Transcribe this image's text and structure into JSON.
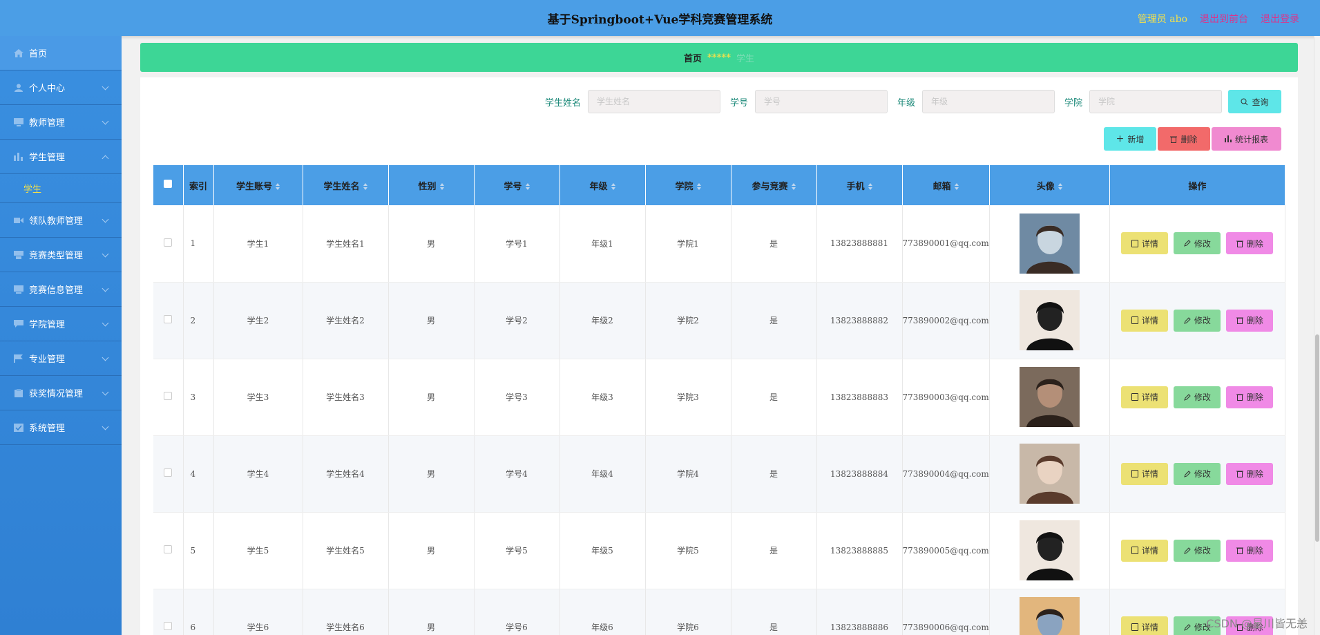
{
  "header": {
    "title": "基于Springboot+Vue学科竞赛管理系统",
    "admin": "管理员 abo",
    "back_to_front": "退出到前台",
    "logout": "退出登录"
  },
  "sidebar": {
    "items": [
      {
        "label": "首页",
        "icon": "home-icon"
      },
      {
        "label": "个人中心",
        "icon": "user-icon"
      },
      {
        "label": "教师管理",
        "icon": "monitor-icon"
      },
      {
        "label": "学生管理",
        "icon": "chart-icon"
      },
      {
        "label": "学生",
        "icon": ""
      },
      {
        "label": "领队教师管理",
        "icon": "video-icon"
      },
      {
        "label": "竞赛类型管理",
        "icon": "printer-icon"
      },
      {
        "label": "竞赛信息管理",
        "icon": "window-icon"
      },
      {
        "label": "学院管理",
        "icon": "chat-icon"
      },
      {
        "label": "专业管理",
        "icon": "flag-icon"
      },
      {
        "label": "获奖情况管理",
        "icon": "clipboard-icon"
      },
      {
        "label": "系统管理",
        "icon": "check-icon"
      }
    ]
  },
  "breadcrumb": {
    "home": "首页",
    "separator": "*****",
    "current": "学生"
  },
  "search": {
    "name_label": "学生姓名",
    "name_placeholder": "学生姓名",
    "no_label": "学号",
    "no_placeholder": "学号",
    "grade_label": "年级",
    "grade_placeholder": "年级",
    "college_label": "学院",
    "college_placeholder": "学院",
    "query_label": "查询"
  },
  "actions": {
    "add": "新增",
    "delete": "删除",
    "report": "统计报表"
  },
  "table": {
    "headers": [
      "索引",
      "学生账号",
      "学生姓名",
      "性别",
      "学号",
      "年级",
      "学院",
      "参与竞赛",
      "手机",
      "邮箱",
      "头像",
      "操作"
    ],
    "rows": [
      {
        "idx": "1",
        "account": "学生1",
        "name": "学生姓名1",
        "gender": "男",
        "no": "学号1",
        "grade": "年级1",
        "college": "学院1",
        "joined": "是",
        "phone": "13823888881",
        "email": "773890001@qq.com"
      },
      {
        "idx": "2",
        "account": "学生2",
        "name": "学生姓名2",
        "gender": "男",
        "no": "学号2",
        "grade": "年级2",
        "college": "学院2",
        "joined": "是",
        "phone": "13823888882",
        "email": "773890002@qq.com"
      },
      {
        "idx": "3",
        "account": "学生3",
        "name": "学生姓名3",
        "gender": "男",
        "no": "学号3",
        "grade": "年级3",
        "college": "学院3",
        "joined": "是",
        "phone": "13823888883",
        "email": "773890003@qq.com"
      },
      {
        "idx": "4",
        "account": "学生4",
        "name": "学生姓名4",
        "gender": "男",
        "no": "学号4",
        "grade": "年级4",
        "college": "学院4",
        "joined": "是",
        "phone": "13823888884",
        "email": "773890004@qq.com"
      },
      {
        "idx": "5",
        "account": "学生5",
        "name": "学生姓名5",
        "gender": "男",
        "no": "学号5",
        "grade": "年级5",
        "college": "学院5",
        "joined": "是",
        "phone": "13823888885",
        "email": "773890005@qq.com"
      },
      {
        "idx": "6",
        "account": "学生6",
        "name": "学生姓名6",
        "gender": "男",
        "no": "学号6",
        "grade": "年级6",
        "college": "学院6",
        "joined": "是",
        "phone": "13823888886",
        "email": "773890006@qq.com"
      }
    ],
    "row_actions": {
      "detail": "详情",
      "edit": "修改",
      "remove": "删除"
    }
  },
  "watermark": "CSDN @星川皆无恙",
  "colors": {
    "header": "#4b9ee6",
    "sidebar": "#3a8fe0",
    "breadcrumb": "#3dd696",
    "accent_yellow": "#f4e14a"
  }
}
